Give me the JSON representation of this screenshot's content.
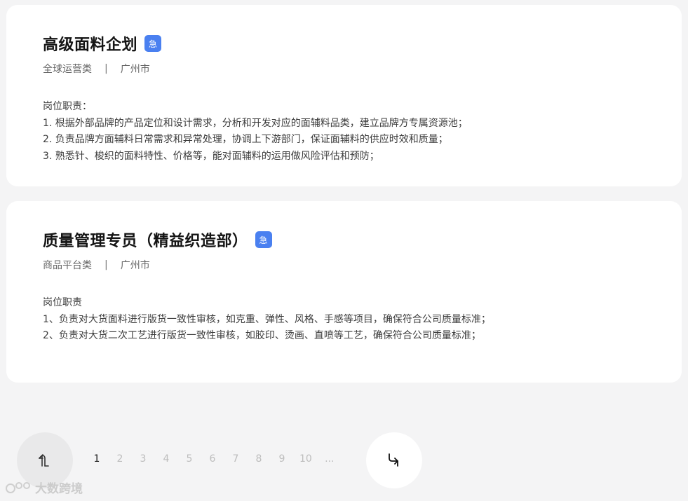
{
  "jobs": [
    {
      "title": "高级面料企划",
      "urgent_badge": "急",
      "department": "全球运营类",
      "separator": "|",
      "city": "广州市",
      "description": [
        "岗位职责：",
        "1. 根据外部品牌的产品定位和设计需求，分析和开发对应的面辅料品类，建立品牌方专属资源池；",
        "2. 负责品牌方面辅料日常需求和异常处理，协调上下游部门，保证面辅料的供应时效和质量；",
        "3. 熟悉针、梭织的面料特性、价格等，能对面辅料的运用做风险评估和预防；"
      ]
    },
    {
      "title": "质量管理专员（精益织造部）",
      "urgent_badge": "急",
      "department": "商品平台类",
      "separator": "|",
      "city": "广州市",
      "description": [
        "岗位职责",
        "1、负责对大货面料进行版货一致性审核，如克重、弹性、风格、手感等项目，确保符合公司质量标准；",
        "2、负责对大货二次工艺进行版货一致性审核，如胶印、烫画、直喷等工艺，确保符合公司质量标准；"
      ]
    }
  ],
  "pagination": {
    "prev_icon": "prev-arrow-icon",
    "next_icon": "next-arrow-icon",
    "pages": [
      "1",
      "2",
      "3",
      "4",
      "5",
      "6",
      "7",
      "8",
      "9",
      "10",
      "..."
    ],
    "current": "1"
  },
  "watermark": {
    "text": "大数跨境"
  },
  "colors": {
    "background": "#f4f4f5",
    "card": "#ffffff",
    "urgent_badge": "#4a80f0",
    "title": "#141414",
    "meta": "#666666"
  }
}
